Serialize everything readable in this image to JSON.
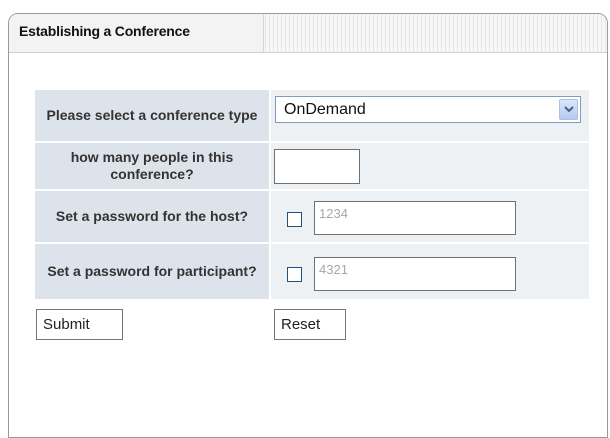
{
  "panel": {
    "title": "Establishing a Conference"
  },
  "form": {
    "conference_type": {
      "label": "Please select a conference type",
      "selected": "OnDemand"
    },
    "people_count": {
      "label": "how many people in this conference?",
      "value": ""
    },
    "host_password": {
      "label": "Set a password for the host?",
      "checked": false,
      "placeholder": "1234"
    },
    "participant_password": {
      "label": "Set a password for participant?",
      "checked": false,
      "placeholder": "4321"
    },
    "submit_label": "Submit",
    "reset_label": "Reset"
  },
  "icons": {
    "dropdown": "chevron-down-icon"
  },
  "colors": {
    "label_bg": "#dde3ea",
    "value_bg": "#edf1f4",
    "select_border": "#7f9db9",
    "checkbox_border": "#1c5180"
  }
}
